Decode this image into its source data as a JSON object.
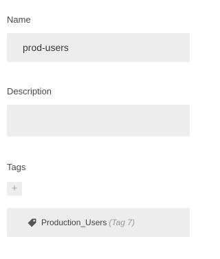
{
  "form": {
    "name": {
      "label": "Name",
      "value": "prod-users"
    },
    "description": {
      "label": "Description",
      "value": ""
    },
    "tags": {
      "label": "Tags",
      "add_button_label": "+",
      "items": [
        {
          "name": "Production_Users",
          "meta": "(Tag 7)",
          "icon": "tag-icon"
        }
      ]
    }
  }
}
